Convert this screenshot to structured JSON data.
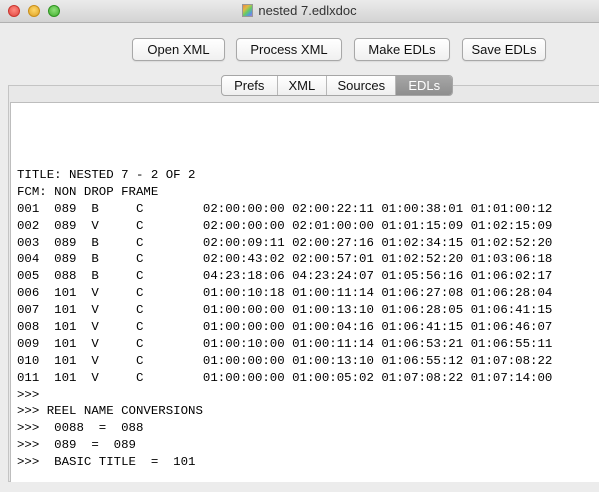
{
  "window": {
    "title": "nested 7.edlxdoc"
  },
  "toolbar": {
    "open_xml": "Open XML",
    "process_xml": "Process XML",
    "make_edls": "Make EDLs",
    "save_edls": "Save EDLs"
  },
  "tabs": [
    "Prefs",
    "XML",
    "Sources",
    "EDLs"
  ],
  "active_tab": "EDLs",
  "edl_lines": [
    "TITLE: NESTED 7 - 2 OF 2",
    "FCM: NON DROP FRAME",
    "001  089  B     C        02:00:00:00 02:00:22:11 01:00:38:01 01:01:00:12",
    "002  089  V     C        02:00:00:00 02:01:00:00 01:01:15:09 01:02:15:09",
    "003  089  B     C        02:00:09:11 02:00:27:16 01:02:34:15 01:02:52:20",
    "004  089  B     C        02:00:43:02 02:00:57:01 01:02:52:20 01:03:06:18",
    "005  088  B     C        04:23:18:06 04:23:24:07 01:05:56:16 01:06:02:17",
    "006  101  V     C        01:00:10:18 01:00:11:14 01:06:27:08 01:06:28:04",
    "007  101  V     C        01:00:00:00 01:00:13:10 01:06:28:05 01:06:41:15",
    "008  101  V     C        01:00:00:00 01:00:04:16 01:06:41:15 01:06:46:07",
    "009  101  V     C        01:00:10:00 01:00:11:14 01:06:53:21 01:06:55:11",
    "010  101  V     C        01:00:00:00 01:00:13:10 01:06:55:12 01:07:08:22",
    "011  101  V     C        01:00:00:00 01:00:05:02 01:07:08:22 01:07:14:00",
    ">>>",
    ">>> REEL NAME CONVERSIONS",
    ">>>  0088  =  088",
    ">>>  089  =  089",
    ">>>  BASIC TITLE  =  101"
  ]
}
